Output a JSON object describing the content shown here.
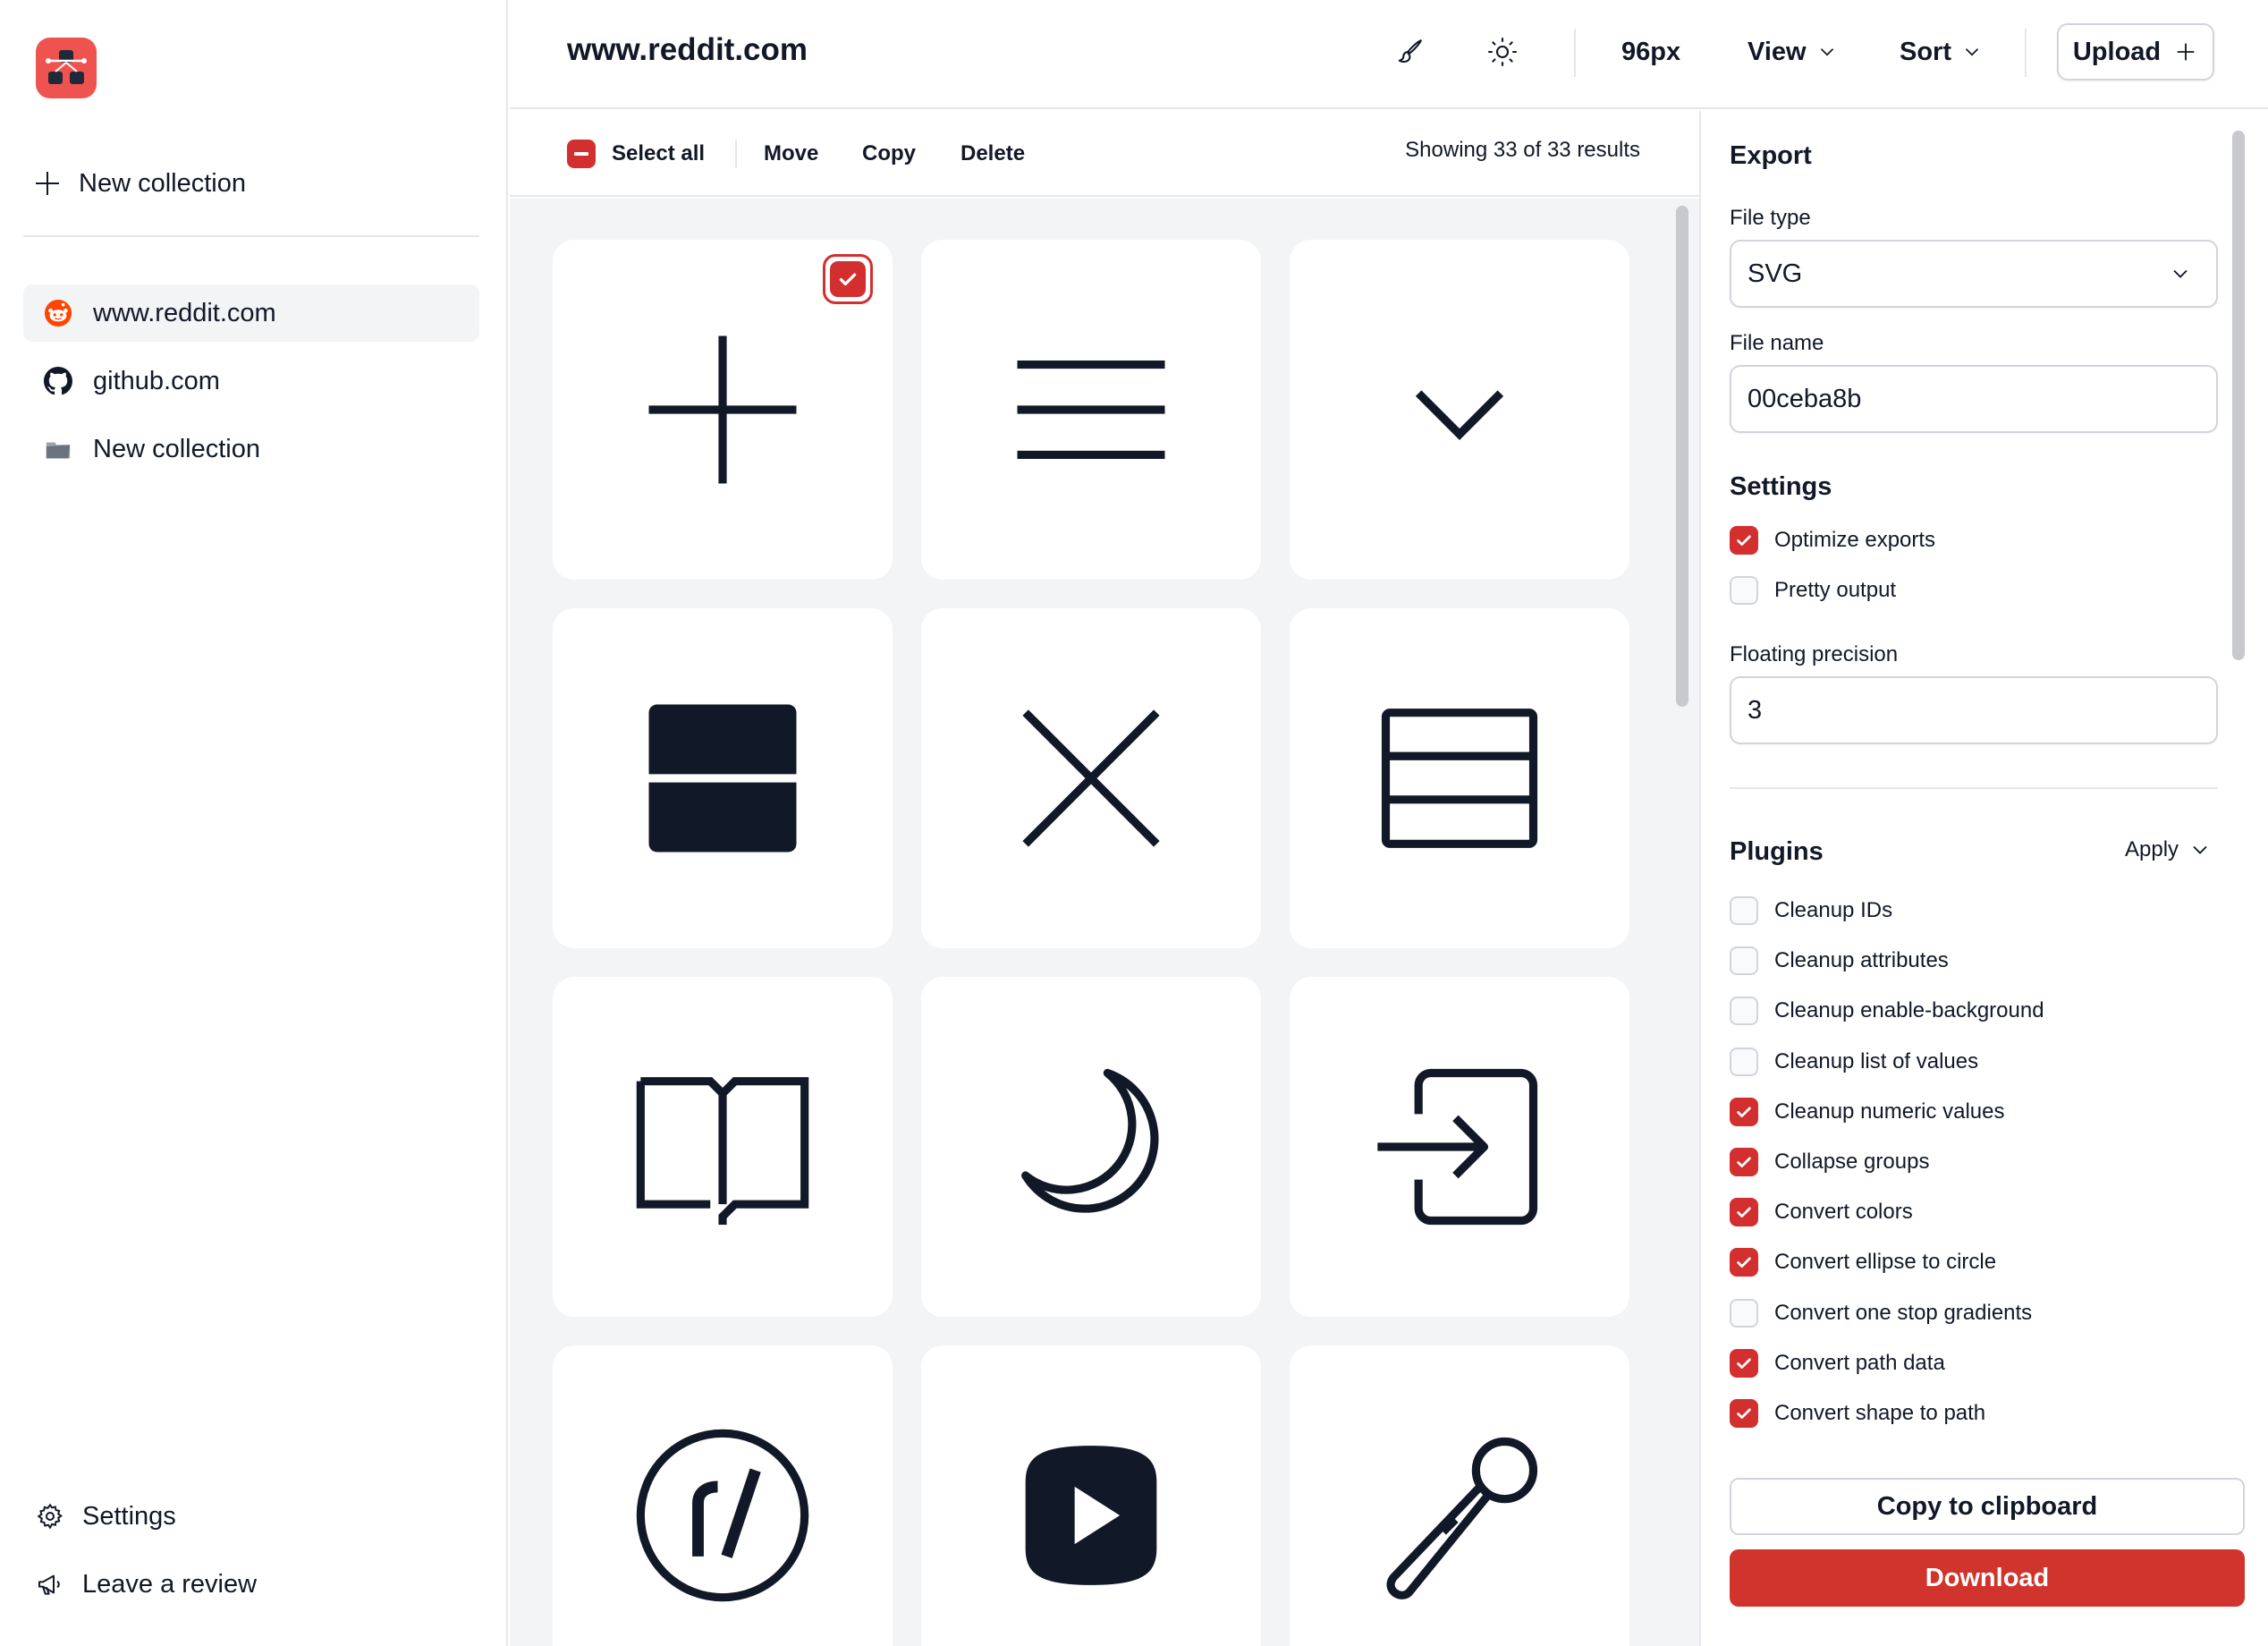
{
  "app": {
    "logo_icon": "app-logo-icon",
    "accent": "#d32f2f"
  },
  "sidebar": {
    "new_collection_label": "New collection",
    "items": [
      {
        "label": "www.reddit.com",
        "icon": "reddit-icon",
        "active": true
      },
      {
        "label": "github.com",
        "icon": "github-icon",
        "active": false
      },
      {
        "label": "New collection",
        "icon": "folder-icon",
        "active": false
      }
    ],
    "bottom": [
      {
        "label": "Settings",
        "icon": "gear-icon"
      },
      {
        "label": "Leave a review",
        "icon": "megaphone-icon"
      }
    ]
  },
  "header": {
    "title": "www.reddit.com",
    "size_label": "96px",
    "view_label": "View",
    "sort_label": "Sort",
    "upload_label": "Upload"
  },
  "toolbar": {
    "select_all_label": "Select all",
    "move_label": "Move",
    "copy_label": "Copy",
    "delete_label": "Delete",
    "results_text": "Showing 33 of 33 results"
  },
  "grid": {
    "icons": [
      "plus-icon",
      "menu-icon",
      "chevron-down-icon",
      "split-block-icon",
      "close-icon",
      "rows-icon",
      "book-icon",
      "moon-icon",
      "login-icon",
      "subreddit-icon",
      "play-icon",
      "microphone-icon"
    ],
    "selected_index": 0
  },
  "export": {
    "title": "Export",
    "file_type_label": "File type",
    "file_type_value": "SVG",
    "file_name_label": "File name",
    "file_name_value": "00ceba8b",
    "settings_title": "Settings",
    "settings": [
      {
        "label": "Optimize exports",
        "checked": true
      },
      {
        "label": "Pretty output",
        "checked": false
      }
    ],
    "precision_label": "Floating precision",
    "precision_value": "3",
    "plugins_title": "Plugins",
    "apply_label": "Apply",
    "plugins": [
      {
        "label": "Cleanup IDs",
        "checked": false
      },
      {
        "label": "Cleanup attributes",
        "checked": false
      },
      {
        "label": "Cleanup enable-background",
        "checked": false
      },
      {
        "label": "Cleanup list of values",
        "checked": false
      },
      {
        "label": "Cleanup numeric values",
        "checked": true
      },
      {
        "label": "Collapse groups",
        "checked": true
      },
      {
        "label": "Convert colors",
        "checked": true
      },
      {
        "label": "Convert ellipse to circle",
        "checked": true
      },
      {
        "label": "Convert one stop gradients",
        "checked": false
      },
      {
        "label": "Convert path data",
        "checked": true
      },
      {
        "label": "Convert shape to path",
        "checked": true
      }
    ],
    "copy_label": "Copy to clipboard",
    "download_label": "Download"
  }
}
